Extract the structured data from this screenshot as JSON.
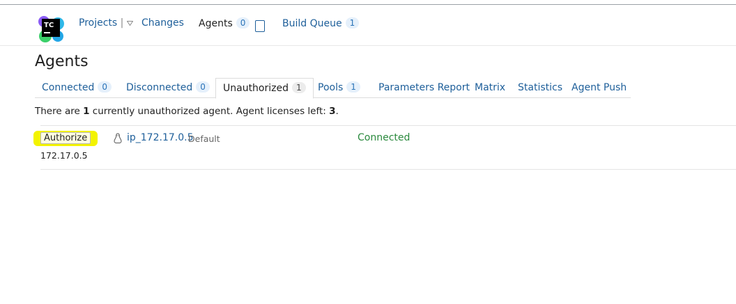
{
  "header": {
    "logo_text": "TC",
    "nav": {
      "projects": "Projects",
      "changes": "Changes",
      "agents": "Agents",
      "agents_count": "0",
      "build_queue": "Build Queue",
      "build_queue_count": "1"
    }
  },
  "page": {
    "title": "Agents",
    "tabs": [
      {
        "label": "Connected",
        "count": "0"
      },
      {
        "label": "Disconnected",
        "count": "0"
      },
      {
        "label": "Unauthorized",
        "count": "1"
      },
      {
        "label": "Pools",
        "count": "1"
      },
      {
        "label": "Parameters Report"
      },
      {
        "label": "Matrix"
      },
      {
        "label": "Statistics"
      },
      {
        "label": "Agent Push"
      }
    ],
    "info": {
      "part1": "There are ",
      "count": "1",
      "part2": " currently unauthorized agent. Agent licenses left: ",
      "licenses": "3",
      "part3": "."
    },
    "agent": {
      "authorize_label": "Authorize",
      "name": "ip_172.17.0.5",
      "pool": "Default",
      "status": "Connected",
      "ip": "172.17.0.5"
    }
  },
  "colors": {
    "link": "#1e5f9a",
    "highlight": "#f3f300",
    "connected": "#2b8a3e"
  }
}
